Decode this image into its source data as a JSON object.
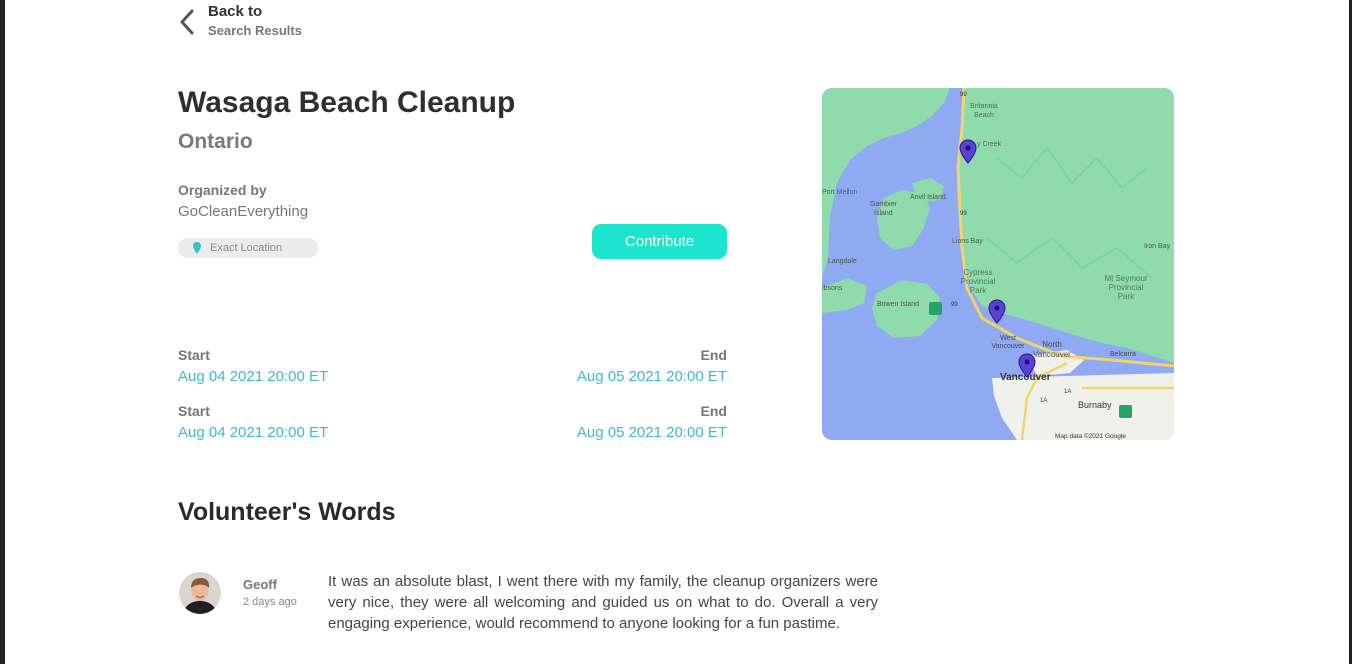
{
  "nav": {
    "back_line1": "Back to",
    "back_line2": "Search Results"
  },
  "event": {
    "title": "Wasaga Beach Cleanup",
    "region": "Ontario",
    "organized_by_label": "Organized by",
    "organizer": "GoCleanEverything",
    "location_badge": "Exact Location",
    "contribute_label": "Contribute"
  },
  "schedule": [
    {
      "start_label": "Start",
      "start": "Aug 04 2021 20:00 ET",
      "end_label": "End",
      "end": "Aug 05 2021 20:00 ET"
    },
    {
      "start_label": "Start",
      "start": "Aug 04 2021 20:00 ET",
      "end_label": "End",
      "end": "Aug 05 2021 20:00 ET"
    }
  ],
  "map": {
    "labels": {
      "britannia": "Britannia",
      "beach": "Beach",
      "creek": "y Creek",
      "port_mellon": "Port Mellon",
      "anvil": "Anvil Island",
      "gambier1": "Gambier",
      "gambier2": "Island",
      "lions_bay": "Lions Bay",
      "iron_bay": "Iron Bay",
      "langdale": "Langdale",
      "cypress1": "Cypress",
      "cypress2": "Provincial",
      "cypress3": "Park",
      "seymour1": "Mt Seymour",
      "seymour2": "Provincial",
      "seymour3": "Park",
      "gibsons": "ibsons",
      "bowen": "Bowen Island",
      "west_van1": "West",
      "west_van2": "Vancouver",
      "north_van1": "North",
      "north_van2": "Vancouver",
      "belcarra": "Belcarra",
      "vancouver": "Vancouver",
      "burnaby": "Burnaby",
      "hwy99a": "99",
      "hwy99b": "99",
      "hwy99c": "99",
      "hwy1a": "1A",
      "hwy1b": "1A",
      "attribution": "Map data ©2021 Google"
    },
    "colors": {
      "water": "#8fa9f3",
      "land": "#8fdbab",
      "pin": "#5b3fd6",
      "road": "#f3d46b"
    }
  },
  "reviews_section": {
    "title": "Volunteer's Words"
  },
  "reviews": [
    {
      "name": "Geoff",
      "time": "2 days ago",
      "text": "It was an absolute blast, I went there with my family, the cleanup organizers were very nice, they were all welcoming and guided us on what to do. Overall a very engaging experience, would recommend to anyone looking for a fun pastime."
    }
  ]
}
